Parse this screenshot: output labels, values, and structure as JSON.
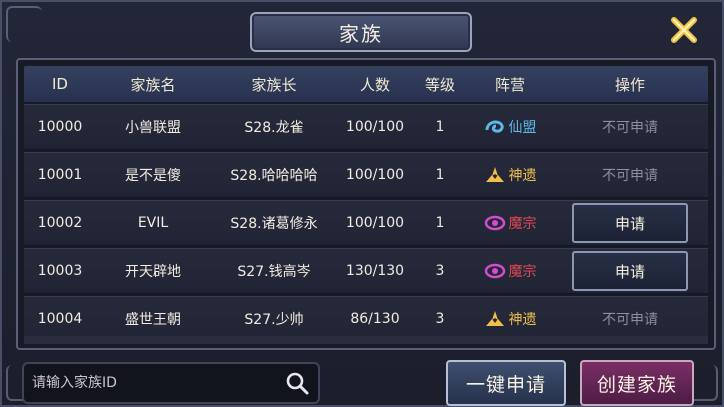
{
  "window": {
    "title": "家族"
  },
  "table": {
    "headers": [
      "ID",
      "家族名",
      "家族长",
      "人数",
      "等级",
      "阵营",
      "操作"
    ],
    "rows": [
      {
        "id": "10000",
        "name": "小兽联盟",
        "leader": "S28.龙雀",
        "members": "100/100",
        "level": "1",
        "camp": "仙盟",
        "camp_color": "#5db7e8",
        "action": "不可申请",
        "can_apply": false
      },
      {
        "id": "10001",
        "name": "是不是傻",
        "leader": "S28.哈哈哈哈",
        "members": "100/100",
        "level": "1",
        "camp": "神遗",
        "camp_color": "#f0c04a",
        "action": "不可申请",
        "can_apply": false
      },
      {
        "id": "10002",
        "name": "EVIL",
        "leader": "S28.诸葛修永",
        "members": "100/100",
        "level": "1",
        "camp": "魔宗",
        "camp_color": "#d64bd0",
        "action": "申请",
        "can_apply": true
      },
      {
        "id": "10003",
        "name": "开天辟地",
        "leader": "S27.钱高岑",
        "members": "130/130",
        "level": "3",
        "camp": "魔宗",
        "camp_color": "#d64bd0",
        "action": "申请",
        "can_apply": true
      },
      {
        "id": "10004",
        "name": "盛世王朝",
        "leader": "S27.少帅",
        "members": "86/130",
        "level": "3",
        "camp": "神遗",
        "camp_color": "#f0c04a",
        "action": "不可申请",
        "can_apply": false
      }
    ]
  },
  "search": {
    "placeholder": "请输入家族ID",
    "value": ""
  },
  "buttons": {
    "one_key_apply": "一键申请",
    "create_family": "创建家族"
  },
  "icons": {
    "close": "close-icon",
    "search": "search-icon"
  }
}
